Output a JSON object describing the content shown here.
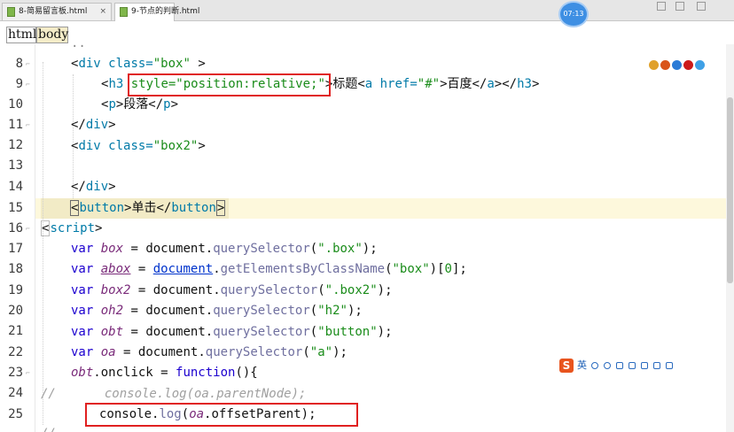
{
  "tabs": [
    {
      "label": "8-简易留言板.html",
      "close": "×"
    },
    {
      "label": "9-节点的判断.html",
      "close": "×"
    }
  ],
  "timer": "07:13",
  "breadcrumb": [
    "html",
    "body"
  ],
  "line_numbers": [
    "8",
    "9",
    "10",
    "11",
    "12",
    "13",
    "14",
    "15",
    "16",
    "17",
    "18",
    "19",
    "20",
    "21",
    "22",
    "23",
    "24",
    "25"
  ],
  "code": {
    "l8": [
      "<",
      "div",
      " class=",
      "\"box\"",
      " >"
    ],
    "l9": [
      "<",
      "h3",
      " ",
      "style=\"position:relative;\"",
      ">标题<",
      "a",
      " href=",
      "\"#\"",
      ">百度</",
      "a",
      "></",
      "h3",
      ">"
    ],
    "l10": [
      "<",
      "p",
      ">段落</",
      "p",
      ">"
    ],
    "l11": [
      "</",
      "div",
      ">"
    ],
    "l12": [
      "<",
      "div",
      " class=",
      "\"box2\"",
      ">"
    ],
    "l14": [
      "</",
      "div",
      ">"
    ],
    "l15": [
      "<",
      "button",
      ">单击</",
      "button",
      ">"
    ],
    "l16": [
      "<",
      "script",
      ">"
    ],
    "l17": [
      "var",
      " ",
      "box",
      " = ",
      "document",
      ".",
      "querySelector",
      "(",
      "\".box\"",
      ");"
    ],
    "l18": [
      "var",
      " ",
      "abox",
      " = ",
      "document",
      ".",
      "getElementsByClassName",
      "(",
      "\"box\"",
      ")[",
      "0",
      "];"
    ],
    "l19": [
      "var",
      " ",
      "box2",
      " = ",
      "document",
      ".",
      "querySelector",
      "(",
      "\".box2\"",
      ");"
    ],
    "l20": [
      "var",
      " ",
      "oh2",
      " = ",
      "document",
      ".",
      "querySelector",
      "(",
      "\"h2\"",
      ");"
    ],
    "l21": [
      "var",
      " ",
      "obt",
      " = ",
      "document",
      ".",
      "querySelector",
      "(",
      "\"button\"",
      ");"
    ],
    "l22": [
      "var",
      " ",
      "oa",
      " = ",
      "document",
      ".",
      "querySelector",
      "(",
      "\"a\"",
      ");"
    ],
    "l23": [
      "obt",
      ".onclick = ",
      "function",
      "(){"
    ],
    "l24": [
      "//",
      "console.log(oa.parentNode);"
    ],
    "l25": [
      "console",
      ".",
      "log",
      "(",
      "oa",
      ".",
      "offsetParent",
      ");"
    ]
  },
  "ime": {
    "logo": "S",
    "mode": "英"
  },
  "colors": {
    "highlight_box": "#e02020",
    "current_line": "#fdf8dc",
    "tag": "#007aa8",
    "string": "#1a8c1a",
    "keyword": "#1c00cf",
    "variable": "#7a2b7a"
  },
  "icons": [
    "file-html-icon",
    "close-icon",
    "chrome-icon",
    "firefox-icon",
    "ie-icon",
    "opera-icon",
    "safari-icon",
    "sogou-ime-icon",
    "mic-icon",
    "keyboard-icon",
    "settings-icon"
  ]
}
